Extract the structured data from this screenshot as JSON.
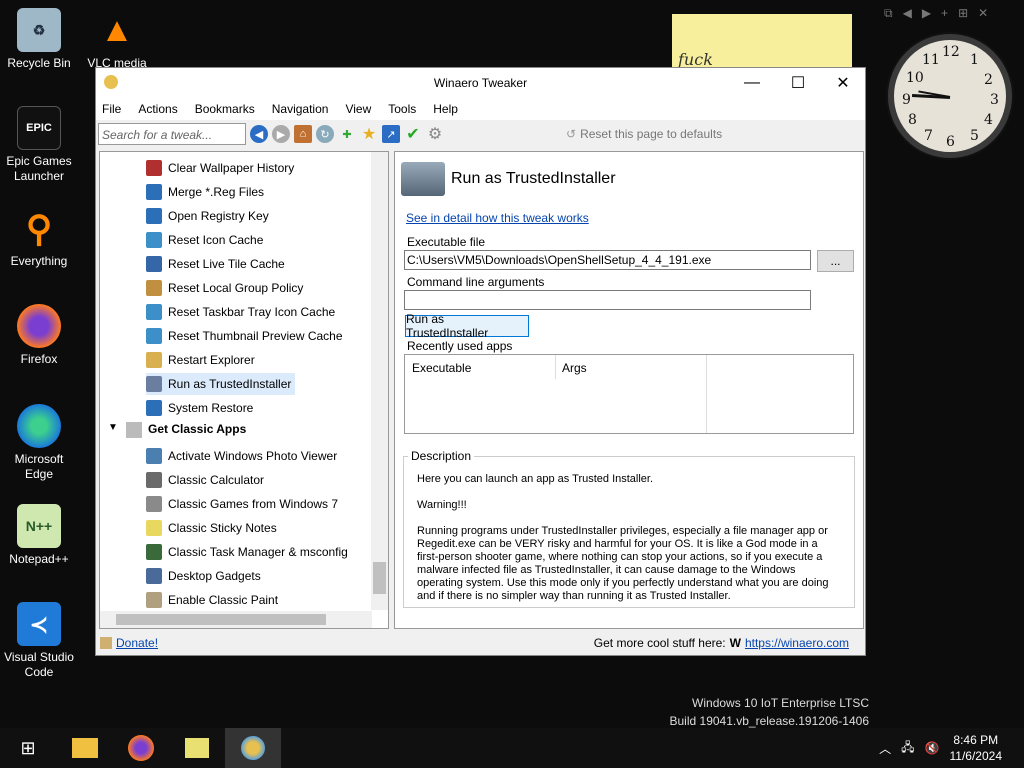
{
  "desktop": {
    "icons": [
      "Recycle Bin",
      "VLC media",
      "Epic Games Launcher",
      "Everything",
      "Firefox",
      "Microsoft Edge",
      "Notepad++",
      "Visual Studio Code"
    ]
  },
  "sticky": {
    "text": "fuck"
  },
  "clock": {
    "numbers": [
      "12",
      "1",
      "2",
      "3",
      "4",
      "5",
      "6",
      "7",
      "8",
      "9",
      "10",
      "11"
    ]
  },
  "watermark": {
    "line1": "Windows 10 IoT Enterprise LTSC",
    "line2": "Build 19041.vb_release.191206-1406"
  },
  "window": {
    "title": "Winaero Tweaker",
    "minimize": "—",
    "maximize": "☐",
    "close": "✕"
  },
  "menu": [
    "File",
    "Actions",
    "Bookmarks",
    "Navigation",
    "View",
    "Tools",
    "Help"
  ],
  "toolbar": {
    "search_placeholder": "Search for a tweak...",
    "reset": "Reset this page to defaults"
  },
  "tree": {
    "items": [
      {
        "label": "Clear Wallpaper History",
        "color": "#b03030"
      },
      {
        "label": "Merge *.Reg Files",
        "color": "#2a6fb8"
      },
      {
        "label": "Open Registry Key",
        "color": "#2a6fb8"
      },
      {
        "label": "Reset Icon Cache",
        "color": "#3d8fc9"
      },
      {
        "label": "Reset Live Tile Cache",
        "color": "#3566a8"
      },
      {
        "label": "Reset Local Group Policy",
        "color": "#c09040"
      },
      {
        "label": "Reset Taskbar Tray Icon Cache",
        "color": "#3d8fc9"
      },
      {
        "label": "Reset Thumbnail Preview Cache",
        "color": "#3d8fc9"
      },
      {
        "label": "Restart Explorer",
        "color": "#d8b050"
      },
      {
        "label": "Run as TrustedInstaller",
        "color": "#6a7fa0"
      },
      {
        "label": "System Restore",
        "color": "#2a6fb8"
      }
    ],
    "group": "Get Classic Apps",
    "group_items": [
      {
        "label": "Activate Windows Photo Viewer",
        "color": "#4a7fb0"
      },
      {
        "label": "Classic Calculator",
        "color": "#6a6a6a"
      },
      {
        "label": "Classic Games from Windows 7",
        "color": "#8a8a8a"
      },
      {
        "label": "Classic Sticky Notes",
        "color": "#e8d860"
      },
      {
        "label": "Classic Task Manager & msconfig",
        "color": "#3a6a3a"
      },
      {
        "label": "Desktop Gadgets",
        "color": "#4a6a9a"
      },
      {
        "label": "Enable Classic Paint",
        "color": "#b0a080"
      }
    ]
  },
  "panel": {
    "heading": "Run as TrustedInstaller",
    "link": "See in detail how this tweak works",
    "exe_label": "Executable file",
    "exe_value": "C:\\Users\\VM5\\Downloads\\OpenShellSetup_4_4_191.exe",
    "browse": "...",
    "args_label": "Command line arguments",
    "run": "Run as TrustedInstaller",
    "recent": "Recently used apps",
    "col1": "Executable",
    "col2": "Args",
    "desc_title": "Description",
    "desc1": "Here you can launch an app as Trusted Installer.",
    "desc2": "Warning!!!",
    "desc3": "Running programs under TrustedInstaller privileges, especially a file manager app or Regedit.exe can be VERY risky and harmful for your OS. It is like a God mode in a first-person shooter game, where nothing can stop your actions, so if you execute a malware infected file as TrustedInstaller, it can cause damage to the Windows operating system. Use this mode only if you perfectly understand what you are doing and if there is no simpler way than running it as Trusted Installer."
  },
  "status": {
    "donate": "Donate!",
    "more": "Get more cool stuff here:",
    "url": "https://winaero.com"
  },
  "tray": {
    "time": "8:46 PM",
    "date": "11/6/2024"
  },
  "colors": {
    "link": "#0645ad",
    "selection": "#dcebfc"
  }
}
